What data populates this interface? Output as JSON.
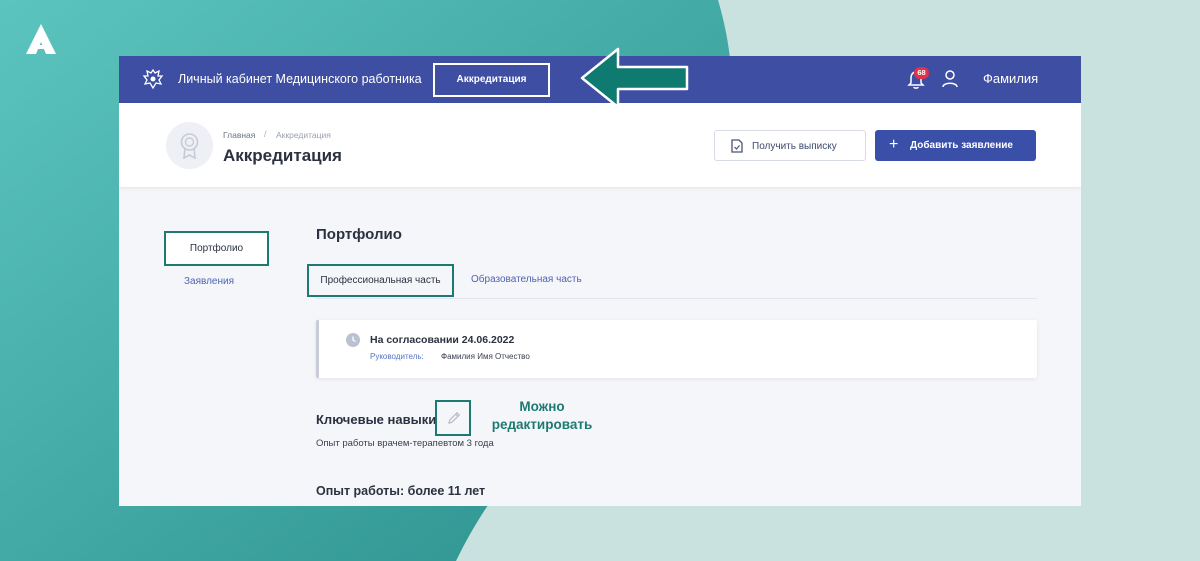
{
  "colors": {
    "teal_dark": "#2f9793",
    "teal_mid": "#4fb8b3",
    "background_light": "#c9e2df",
    "topbar": "#3d4ea3",
    "primary_button": "#3a4fa8",
    "highlight_outline": "#1d7a72",
    "badge": "#e0334a"
  },
  "topbar": {
    "app_title": "Личный кабинет Медицинского работника",
    "nav_item": "Аккредитация",
    "notifications_count": "68",
    "user_name": "Фамилия",
    "icons": [
      "emblem-icon",
      "bell-icon",
      "user-icon"
    ]
  },
  "header": {
    "breadcrumb": {
      "home": "Главная",
      "separator": "/",
      "current": "Аккредитация"
    },
    "page_title": "Аккредитация",
    "extract_button": "Получить выписку",
    "add_button": "Добавить заявление",
    "icons": [
      "award-icon",
      "document-icon",
      "plus-icon"
    ]
  },
  "sidebar": {
    "items": [
      {
        "label": "Портфолио",
        "active": true
      },
      {
        "label": "Заявления",
        "active": false
      }
    ]
  },
  "main": {
    "section_title": "Портфолио",
    "tabs": [
      {
        "label": "Профессиональная часть",
        "active": true
      },
      {
        "label": "Образовательная часть",
        "active": false
      }
    ],
    "status_card": {
      "status": "На согласовании 24.06.2022",
      "manager_label": "Руководитель:",
      "manager_name": "Фамилия Имя Отчество",
      "icon": "clock-icon"
    },
    "skills": {
      "title": "Ключевые навыки",
      "text": "Опыт работы врачем-терапевтом 3 года",
      "edit_icon": "pencil-icon"
    },
    "experience_title": "Опыт работы: более 11 лет"
  },
  "annotation": {
    "line1": "Можно",
    "line2": "редактировать"
  }
}
